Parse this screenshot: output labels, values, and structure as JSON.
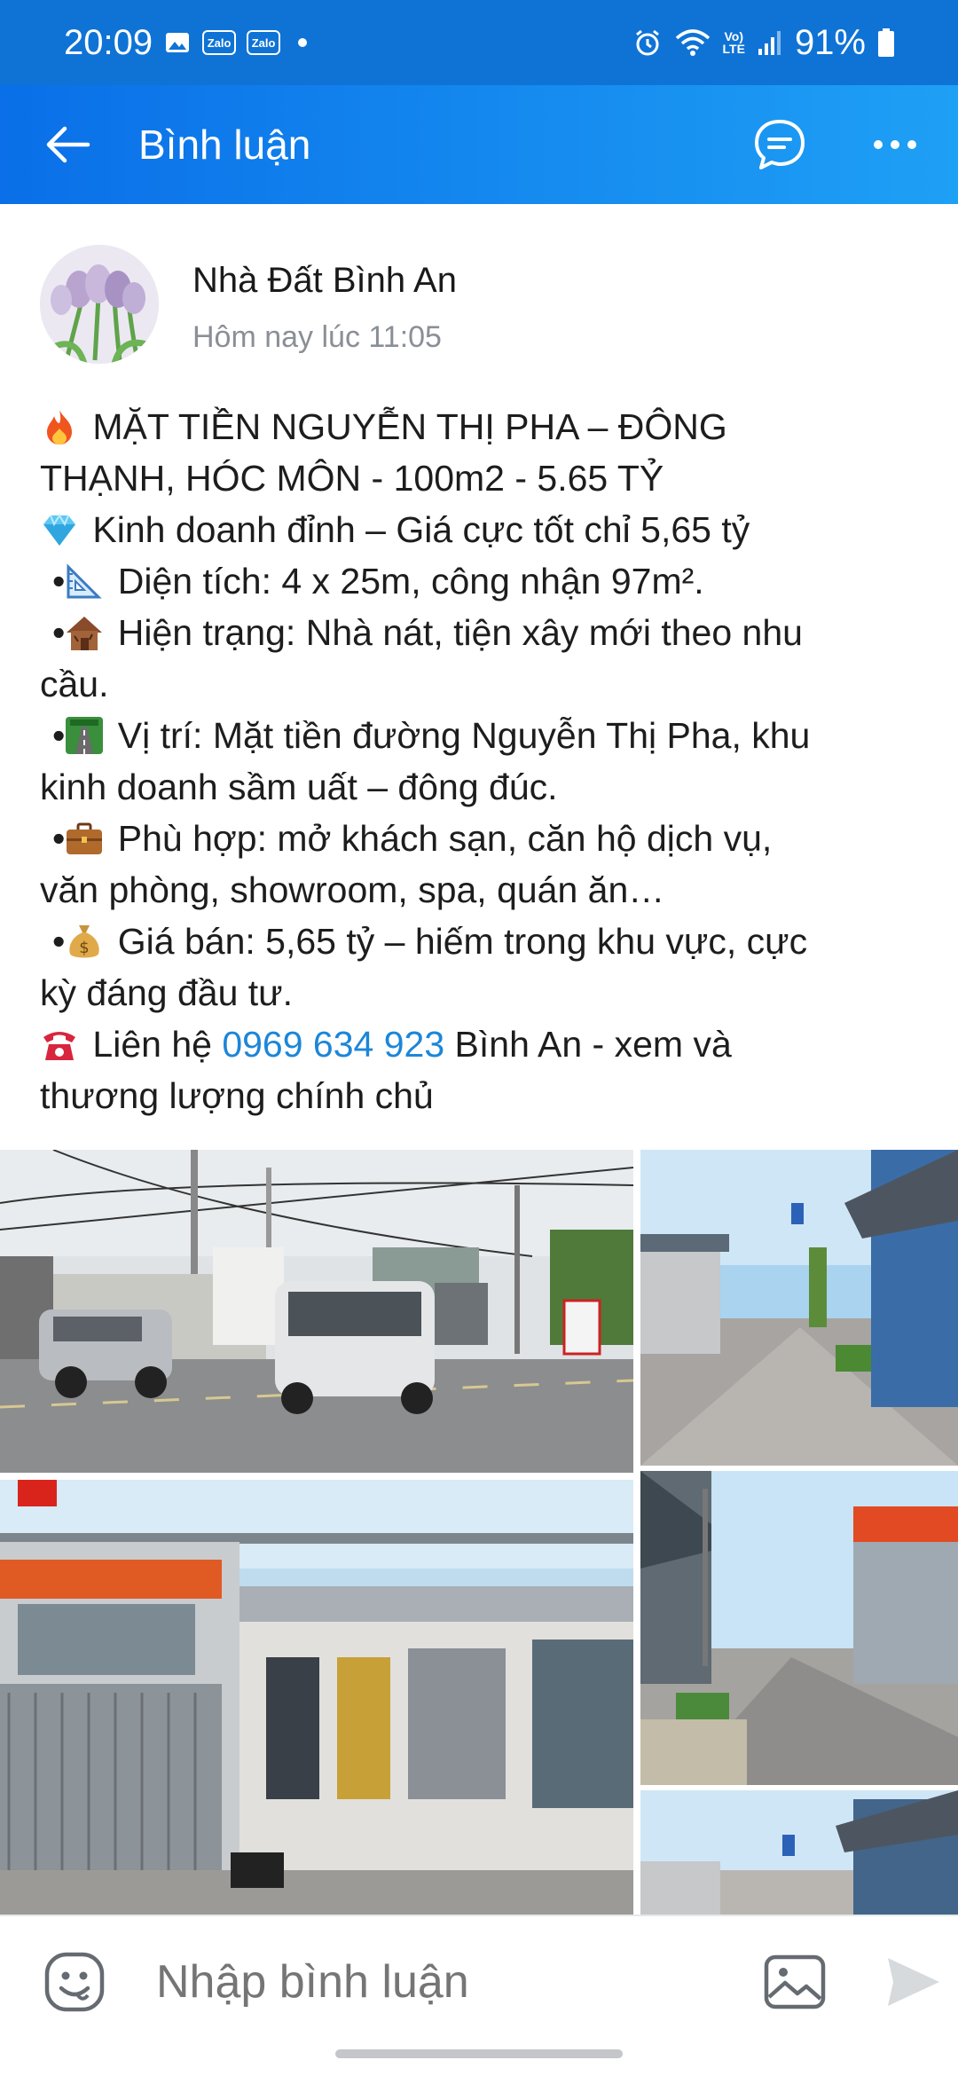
{
  "status_bar": {
    "time": "20:09",
    "zalo_1": "Zalo",
    "zalo_2": "Zalo",
    "lte_top": "Vo)",
    "lte_bottom": "LTE",
    "battery": "91%"
  },
  "header": {
    "title": "Bình luận",
    "back_icon": "arrow-left-icon",
    "chat_icon": "chat-bubble-icon",
    "more_icon": "more-horizontal-icon"
  },
  "post": {
    "author": "Nhà Đất Bình An",
    "timestamp": "Hôm nay lúc 11:05",
    "lines": {
      "l1_a": "MẶT TIỀN NGUYỄN THỊ PHA – ĐÔNG",
      "l1_b": "THẠNH, HÓC MÔN - 100m2 - 5.65 TỶ",
      "l2": "Kinh doanh đỉnh – Giá cực tốt chỉ 5,65 tỷ",
      "l3": "Diện tích: 4 x 25m, công nhận 97m².",
      "l4_a": "Hiện trạng: Nhà nát, tiện xây mới theo nhu",
      "l4_b": "cầu.",
      "l5_a": "Vị trí: Mặt tiền đường Nguyễn Thị Pha, khu",
      "l5_b": "kinh doanh sầm uất – đông đúc.",
      "l6_a": "Phù hợp: mở khách sạn, căn hộ dịch vụ,",
      "l6_b": "văn phòng, showroom, spa, quán ăn…",
      "l7_a": "Giá bán: 5,65 tỷ – hiếm trong khu vực, cực",
      "l7_b": "kỳ đáng đầu tư.",
      "l8_prefix": "Liên hệ",
      "l8_phone": "0969 634 923",
      "l8_suffix": "Bình An - xem và",
      "l8_b": "thương lượng chính chủ"
    },
    "bullet_char": "•"
  },
  "composer": {
    "placeholder": "Nhập bình luận",
    "emoji_icon": "emoji-face-icon",
    "image_icon": "image-icon",
    "send_icon": "send-icon"
  },
  "colors": {
    "header_start": "#0a6fe8",
    "header_end": "#1ea0f5",
    "link": "#1c86d8",
    "status_bar": "#0f73d6"
  }
}
